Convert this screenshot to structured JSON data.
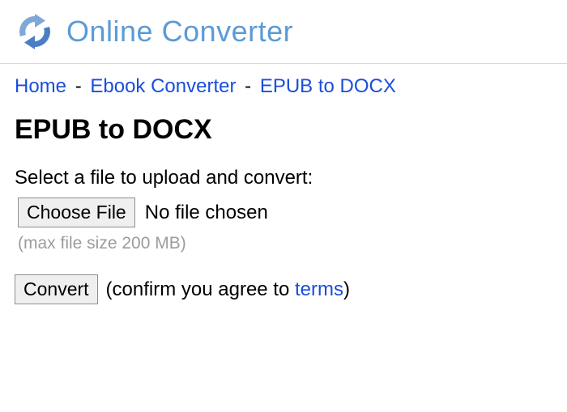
{
  "header": {
    "site_title": "Online Converter"
  },
  "breadcrumb": {
    "home": "Home",
    "section": "Ebook Converter",
    "page": "EPUB to DOCX",
    "sep": "-"
  },
  "page": {
    "title": "EPUB to DOCX",
    "prompt": "Select a file to upload and convert:",
    "choose_label": "Choose File",
    "file_status": "No file chosen",
    "hint": "(max file size 200 MB)",
    "convert_label": "Convert",
    "agree_prefix": "(confirm you agree to ",
    "terms_label": "terms",
    "agree_suffix": ")"
  }
}
